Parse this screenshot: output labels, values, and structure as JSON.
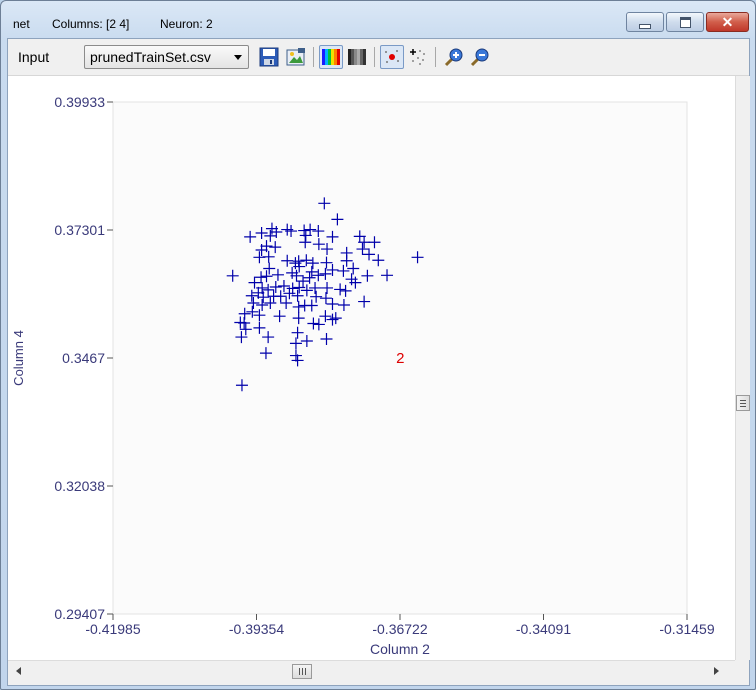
{
  "title_bar": {
    "net_label": "net",
    "columns_text": "Columns: [2  4]",
    "neuron_text": "Neuron: 2"
  },
  "toolbar": {
    "input_label": "Input",
    "file_select_value": "prunedTrainSet.csv"
  },
  "icons": [
    "save-icon",
    "export-image-icon",
    "color-palette-icon",
    "grayscale-icon",
    "show-points-icon",
    "scatter-icon",
    "zoom-in-icon",
    "zoom-out-icon"
  ],
  "colors": {
    "marker": "#0000aa",
    "neuron_label": "#dd0000",
    "axis_text": "#3a3a7a"
  },
  "chart_data": {
    "type": "scatter",
    "title": "",
    "xlabel": "Column 2",
    "ylabel": "Column 4",
    "xlim": [
      -0.41985,
      -0.31459
    ],
    "ylim": [
      0.29407,
      0.39933
    ],
    "x_ticks": [
      "-0.41985",
      "-0.39354",
      "-0.36722",
      "-0.34091",
      "-0.31459"
    ],
    "y_ticks": [
      "0.39933",
      "0.37301",
      "0.3467",
      "0.32038",
      "0.29407"
    ],
    "marker": "plus",
    "neuron_label": {
      "text": "2",
      "x": -0.3672,
      "y": 0.3467
    },
    "points": [
      [
        -0.3811,
        0.3785
      ],
      [
        -0.3787,
        0.3752
      ],
      [
        -0.3796,
        0.3716
      ],
      [
        -0.3822,
        0.3728
      ],
      [
        -0.3837,
        0.3731
      ],
      [
        -0.3848,
        0.3729
      ],
      [
        -0.3872,
        0.3728
      ],
      [
        -0.3879,
        0.3731
      ],
      [
        -0.3899,
        0.3726
      ],
      [
        -0.3907,
        0.3733
      ],
      [
        -0.391,
        0.3718
      ],
      [
        -0.3926,
        0.3724
      ],
      [
        -0.3947,
        0.3716
      ],
      [
        -0.3917,
        0.3697
      ],
      [
        -0.3901,
        0.3695
      ],
      [
        -0.3926,
        0.3689
      ],
      [
        -0.3913,
        0.3675
      ],
      [
        -0.393,
        0.3674
      ],
      [
        -0.3879,
        0.3667
      ],
      [
        -0.3864,
        0.3662
      ],
      [
        -0.3858,
        0.3666
      ],
      [
        -0.3844,
        0.3668
      ],
      [
        -0.3832,
        0.3662
      ],
      [
        -0.3807,
        0.3663
      ],
      [
        -0.3806,
        0.3691
      ],
      [
        -0.3821,
        0.3701
      ],
      [
        -0.3846,
        0.3705
      ],
      [
        -0.3845,
        0.3719
      ],
      [
        -0.377,
        0.3667
      ],
      [
        -0.3758,
        0.3651
      ],
      [
        -0.3776,
        0.3646
      ],
      [
        -0.3796,
        0.3648
      ],
      [
        -0.3809,
        0.364
      ],
      [
        -0.3822,
        0.3637
      ],
      [
        -0.3834,
        0.3644
      ],
      [
        -0.3857,
        0.3655
      ],
      [
        -0.3862,
        0.3636
      ],
      [
        -0.387,
        0.3642
      ],
      [
        -0.3896,
        0.3638
      ],
      [
        -0.3912,
        0.3651
      ],
      [
        -0.3917,
        0.3635
      ],
      [
        -0.3927,
        0.3633
      ],
      [
        -0.3979,
        0.3636
      ],
      [
        -0.3939,
        0.3622
      ],
      [
        -0.3925,
        0.3611
      ],
      [
        -0.3914,
        0.3607
      ],
      [
        -0.39,
        0.3613
      ],
      [
        -0.3885,
        0.3615
      ],
      [
        -0.3869,
        0.361
      ],
      [
        -0.3857,
        0.3612
      ],
      [
        -0.385,
        0.3625
      ],
      [
        -0.3838,
        0.3632
      ],
      [
        -0.3828,
        0.3611
      ],
      [
        -0.3806,
        0.3611
      ],
      [
        -0.3782,
        0.3608
      ],
      [
        -0.3761,
        0.3629
      ],
      [
        -0.3754,
        0.3622
      ],
      [
        -0.3732,
        0.3636
      ],
      [
        -0.377,
        0.3683
      ],
      [
        -0.3746,
        0.3717
      ],
      [
        -0.3741,
        0.3691
      ],
      [
        -0.3738,
        0.3705
      ],
      [
        -0.3719,
        0.3705
      ],
      [
        -0.3729,
        0.368
      ],
      [
        -0.3712,
        0.3668
      ],
      [
        -0.3696,
        0.3637
      ],
      [
        -0.364,
        0.3674
      ],
      [
        -0.3932,
        0.3601
      ],
      [
        -0.3944,
        0.3595
      ],
      [
        -0.3923,
        0.3592
      ],
      [
        -0.3904,
        0.3594
      ],
      [
        -0.3891,
        0.3594
      ],
      [
        -0.3875,
        0.36
      ],
      [
        -0.386,
        0.3595
      ],
      [
        -0.3843,
        0.3606
      ],
      [
        -0.3826,
        0.3593
      ],
      [
        -0.3808,
        0.359
      ],
      [
        -0.3772,
        0.3605
      ],
      [
        -0.3738,
        0.3583
      ],
      [
        -0.3941,
        0.358
      ],
      [
        -0.3925,
        0.3576
      ],
      [
        -0.391,
        0.358
      ],
      [
        -0.3881,
        0.358
      ],
      [
        -0.3858,
        0.3572
      ],
      [
        -0.3847,
        0.3575
      ],
      [
        -0.3834,
        0.3575
      ],
      [
        -0.3796,
        0.3578
      ],
      [
        -0.3775,
        0.3576
      ],
      [
        -0.3943,
        0.3562
      ],
      [
        -0.3957,
        0.3558
      ],
      [
        -0.393,
        0.3555
      ],
      [
        -0.3893,
        0.3553
      ],
      [
        -0.3858,
        0.3549
      ],
      [
        -0.3809,
        0.3553
      ],
      [
        -0.379,
        0.3549
      ],
      [
        -0.3831,
        0.3538
      ],
      [
        -0.3821,
        0.3536
      ],
      [
        -0.3796,
        0.3546
      ],
      [
        -0.3958,
        0.3539
      ],
      [
        -0.3965,
        0.354
      ],
      [
        -0.393,
        0.3529
      ],
      [
        -0.3914,
        0.351
      ],
      [
        -0.3955,
        0.3526
      ],
      [
        -0.3963,
        0.351
      ],
      [
        -0.386,
        0.3519
      ],
      [
        -0.3863,
        0.3497
      ],
      [
        -0.3843,
        0.3502
      ],
      [
        -0.3807,
        0.3506
      ],
      [
        -0.3918,
        0.3477
      ],
      [
        -0.3863,
        0.3472
      ],
      [
        -0.386,
        0.3462
      ],
      [
        -0.3962,
        0.3411
      ]
    ]
  }
}
